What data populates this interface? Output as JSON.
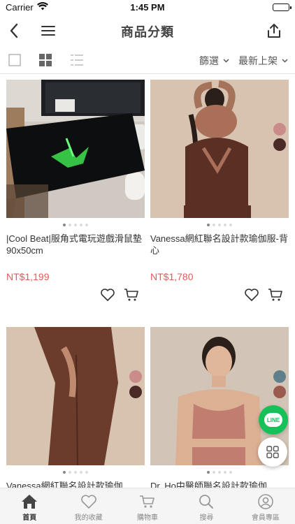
{
  "status_bar": {
    "carrier": "Carrier",
    "time": "1:45 PM"
  },
  "nav": {
    "title": "商品分類"
  },
  "filter": {
    "filter_label": "篩選",
    "sort_label": "最新上架"
  },
  "products": [
    {
      "name": "|Cool Beat|服角式電玩遊戲滑鼠墊 90x50cm",
      "price": "NT$1,199"
    },
    {
      "name": "Vanessa網紅聯名設計款瑜伽服-背心",
      "price": "NT$1,780",
      "swatches": [
        "#c98c88",
        "#4a2a26"
      ]
    },
    {
      "name": "Vanessa網紅聯名設計款瑜伽",
      "price": "",
      "swatches": [
        "#c98c88",
        "#4a2a26"
      ]
    },
    {
      "name": "Dr. Ho中醫師聯名設計款瑜伽",
      "price": "",
      "swatches": [
        "#5f7f8a",
        "#9a5b4e"
      ]
    }
  ],
  "fab": {
    "line_label": "LINE"
  },
  "tabs": [
    {
      "label": "首頁",
      "icon": "home-icon"
    },
    {
      "label": "我的收藏",
      "icon": "heart-icon"
    },
    {
      "label": "購物車",
      "icon": "cart-icon"
    },
    {
      "label": "搜尋",
      "icon": "search-icon"
    },
    {
      "label": "會員專區",
      "icon": "user-icon"
    }
  ],
  "colors": {
    "price": "#e05c5c",
    "line_green": "#17c15a"
  }
}
